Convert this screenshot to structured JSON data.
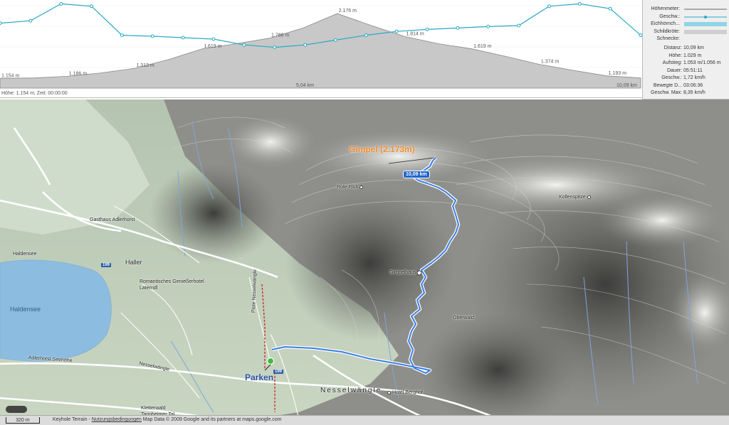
{
  "profile": {
    "status": "Höhe: 1.154 m; Zeit: 00:00:00",
    "elevation_labels": [
      "1.154 m",
      "1.186 m",
      "1.313 m",
      "1.619 m",
      "1.788 m",
      "2.176 m",
      "1.814 m",
      "1.619 m",
      "1.374 m",
      "1.193 m",
      "10,09 km"
    ],
    "midpoint_label": "5,04 km",
    "elevation_series": [
      1154,
      1160,
      1186,
      1240,
      1313,
      1450,
      1619,
      1700,
      1788,
      1950,
      2176,
      1990,
      1814,
      1700,
      1619,
      1500,
      1374,
      1280,
      1193,
      1160
    ],
    "speed_series": [
      0.55,
      0.6,
      0.95,
      0.9,
      0.3,
      0.28,
      0.25,
      0.22,
      0.1,
      0.05,
      0.1,
      0.2,
      0.3,
      0.38,
      0.42,
      0.45,
      0.48,
      0.5,
      0.9,
      0.95,
      0.85,
      0.3
    ]
  },
  "legend": {
    "items": [
      {
        "label": "Höhenmeter:",
        "kind": "line",
        "color": "#666666"
      },
      {
        "label": "Geschw.:",
        "kind": "dotline",
        "color": "#27a9c4"
      },
      {
        "label": "Eichhörnch...",
        "kind": "band",
        "color": "#8fd4e6"
      },
      {
        "label": "Schildkröte:",
        "kind": "band",
        "color": "#cfcfcf"
      },
      {
        "label": "Schnecke:",
        "kind": "none",
        "color": "#efefef"
      }
    ]
  },
  "stats": [
    {
      "label": "Distanz:",
      "value": "10,09 km"
    },
    {
      "label": "Höhe:",
      "value": "1.029 m"
    },
    {
      "label": "Aufstieg:",
      "value": "1.053 m/1.056 m"
    },
    {
      "label": "Dauer:",
      "value": "05:51:11"
    },
    {
      "label": "Geschw.:",
      "value": "1,72 km/h"
    },
    {
      "label": "Bewegte D...",
      "value": "03:06:36"
    },
    {
      "label": "Geschw. Max:",
      "value": "8,35 km/h"
    }
  ],
  "map": {
    "summit": "Gimpel (2.173m)",
    "distance_badge": "10,09 km",
    "parking": "Parken",
    "places": {
      "rote_fluh": "Rote Flüh",
      "kollenspitze": "Kollenspitze",
      "gimpelhaus": "Gimpelhaus",
      "oberwald": "Oberwald",
      "haller": "Haller",
      "haldensee_label": "Haldensee",
      "haldensee_water": "Haldensee",
      "hotel": "Romantisches Genießerhotel Laterndl",
      "nesselwangle": "Nesselwängle",
      "hotel_berghof": "Hotel Berghof",
      "kletterwald": "Kletterwald Tannheimer Tal",
      "gasthaus": "Gasthaus Adlerhorst",
      "piste": "Piste Nesselwängle",
      "road_nesselwangle": "Nesselwängle",
      "adlerhorst_road": "Adlerhorst Seehöhe"
    },
    "road_number": "199"
  },
  "footer": {
    "scale": "320 m",
    "attrib_prefix": "Keyhole Terrain -",
    "terms": "Nutzungsbedingungen",
    "attrib_suffix": "Map Data © 2009 Google and its partners at maps.google.com"
  }
}
